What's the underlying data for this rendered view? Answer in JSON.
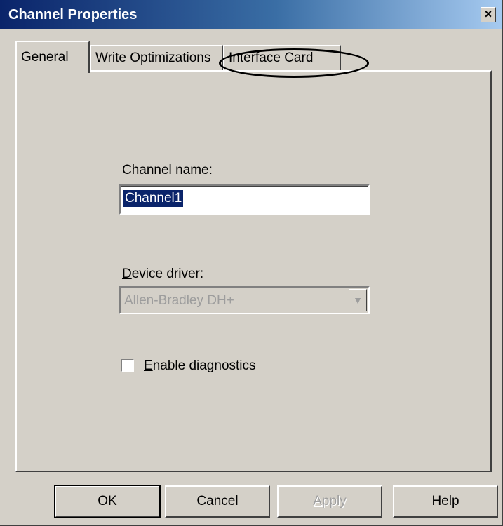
{
  "window": {
    "title": "Channel Properties",
    "close_label": "×"
  },
  "tabs": [
    {
      "label": "General",
      "active": true
    },
    {
      "label": "Write Optimizations",
      "active": false
    },
    {
      "label": "Interface Card",
      "active": false
    }
  ],
  "form": {
    "channel_name": {
      "label_prefix": "Channel ",
      "label_accel": "n",
      "label_suffix": "ame:",
      "value": "Channel1"
    },
    "device_driver": {
      "label_accel": "D",
      "label_suffix": "evice driver:",
      "value": "Allen-Bradley DH+",
      "dropdown_icon": "▼"
    },
    "diagnostics": {
      "label_accel": "E",
      "label_suffix": "nable diagnostics",
      "checked": false
    }
  },
  "buttons": {
    "ok": "OK",
    "cancel": "Cancel",
    "apply_accel": "A",
    "apply_suffix": "pply",
    "help": "Help"
  }
}
